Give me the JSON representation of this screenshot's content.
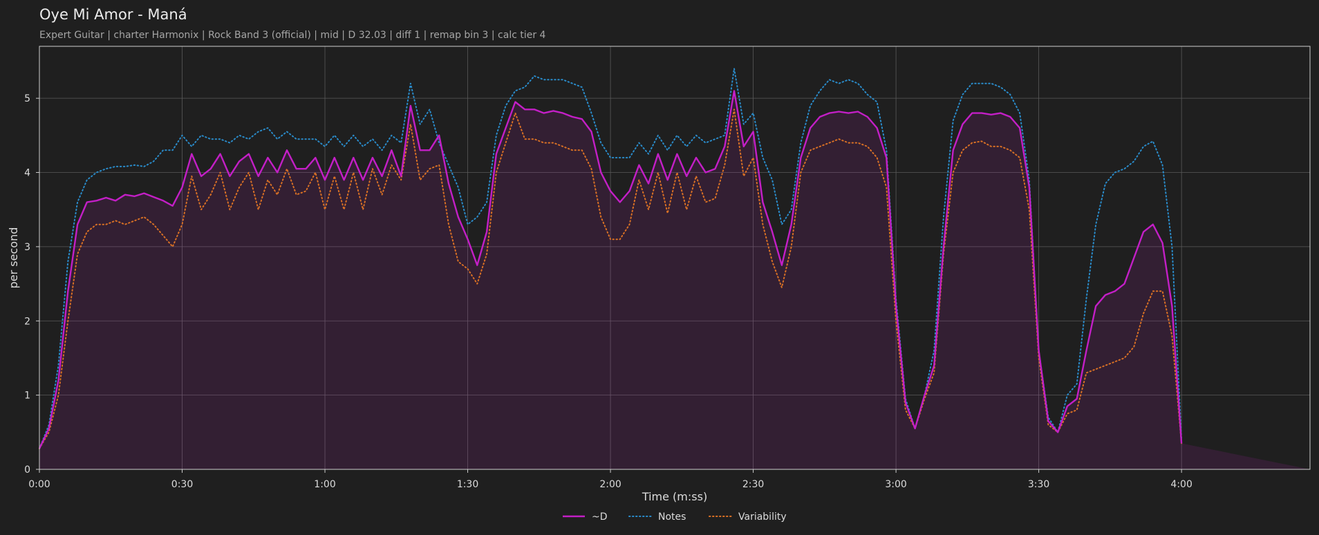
{
  "chart_data": {
    "type": "line",
    "title": "Oye Mi Amor - Maná",
    "subtitle": "Expert Guitar  |  charter Harmonix  |  Rock Band 3 (official)  |  mid  |  D 32.03  |  diff 1  |  remap bin 3  |  calc tier 4",
    "xlabel": "Time (m:ss)",
    "ylabel": "per second",
    "xlim": [
      0,
      267
    ],
    "ylim": [
      0,
      5.7
    ],
    "grid": true,
    "legend_position": "bottom-center",
    "x_ticks": [
      {
        "value": 0,
        "label": "0:00"
      },
      {
        "value": 30,
        "label": "0:30"
      },
      {
        "value": 60,
        "label": "1:00"
      },
      {
        "value": 90,
        "label": "1:30"
      },
      {
        "value": 120,
        "label": "2:00"
      },
      {
        "value": 150,
        "label": "2:30"
      },
      {
        "value": 180,
        "label": "3:00"
      },
      {
        "value": 210,
        "label": "3:30"
      },
      {
        "value": 240,
        "label": "4:00"
      }
    ],
    "y_ticks": [
      {
        "value": 0,
        "label": "0"
      },
      {
        "value": 1,
        "label": "1"
      },
      {
        "value": 2,
        "label": "2"
      },
      {
        "value": 3,
        "label": "3"
      },
      {
        "value": 4,
        "label": "4"
      },
      {
        "value": 5,
        "label": "5"
      }
    ],
    "x": [
      0,
      2,
      4,
      6,
      8,
      10,
      12,
      14,
      16,
      18,
      20,
      22,
      24,
      26,
      28,
      30,
      32,
      34,
      36,
      38,
      40,
      42,
      44,
      46,
      48,
      50,
      52,
      54,
      56,
      58,
      60,
      62,
      64,
      66,
      68,
      70,
      72,
      74,
      76,
      78,
      80,
      82,
      84,
      86,
      88,
      90,
      92,
      94,
      96,
      98,
      100,
      102,
      104,
      106,
      108,
      110,
      112,
      114,
      116,
      118,
      120,
      122,
      124,
      126,
      128,
      130,
      132,
      134,
      136,
      138,
      140,
      142,
      144,
      146,
      148,
      150,
      152,
      154,
      156,
      158,
      160,
      162,
      164,
      166,
      168,
      170,
      172,
      174,
      176,
      178,
      180,
      182,
      184,
      186,
      188,
      190,
      192,
      194,
      196,
      198,
      200,
      202,
      204,
      206,
      208,
      210,
      212,
      214,
      216,
      218,
      220,
      222,
      224,
      226,
      228,
      230,
      232,
      234,
      236,
      238,
      240,
      242,
      244,
      246,
      248,
      250,
      252,
      254,
      256,
      258,
      260,
      262,
      264,
      266,
      267
    ],
    "series": [
      {
        "name": "~D",
        "style": "solid",
        "color": "#c31fc6",
        "fill": true,
        "values": [
          0.28,
          0.55,
          1.2,
          2.4,
          3.3,
          3.6,
          3.62,
          3.66,
          3.62,
          3.7,
          3.68,
          3.72,
          3.67,
          3.62,
          3.55,
          3.8,
          4.25,
          3.95,
          4.05,
          4.25,
          3.95,
          4.15,
          4.25,
          3.95,
          4.2,
          4.0,
          4.3,
          4.05,
          4.05,
          4.2,
          3.9,
          4.2,
          3.9,
          4.2,
          3.9,
          4.2,
          3.95,
          4.3,
          3.95,
          4.9,
          4.3,
          4.3,
          4.5,
          3.85,
          3.4,
          3.1,
          2.75,
          3.2,
          4.25,
          4.6,
          4.95,
          4.85,
          4.85,
          4.8,
          4.83,
          4.8,
          4.75,
          4.72,
          4.55,
          4.0,
          3.75,
          3.6,
          3.75,
          4.1,
          3.85,
          4.25,
          3.9,
          4.25,
          3.95,
          4.2,
          4.0,
          4.05,
          4.35,
          5.1,
          4.35,
          4.55,
          3.6,
          3.2,
          2.75,
          3.3,
          4.2,
          4.6,
          4.75,
          4.8,
          4.82,
          4.8,
          4.82,
          4.75,
          4.6,
          4.2,
          2.2,
          0.9,
          0.55,
          1.0,
          1.4,
          3.0,
          4.3,
          4.65,
          4.8,
          4.8,
          4.78,
          4.8,
          4.75,
          4.6,
          3.8,
          1.6,
          0.65,
          0.5,
          0.85,
          0.95,
          1.6,
          2.2,
          2.35,
          2.4,
          2.5,
          2.85,
          3.2,
          3.3,
          3.05,
          2.2,
          0.35
        ]
      },
      {
        "name": "Notes",
        "style": "dotted",
        "color": "#2a8bc9",
        "fill": false,
        "values": [
          0.28,
          0.6,
          1.4,
          2.8,
          3.6,
          3.9,
          4.0,
          4.05,
          4.08,
          4.08,
          4.1,
          4.08,
          4.15,
          4.3,
          4.3,
          4.5,
          4.35,
          4.5,
          4.45,
          4.45,
          4.4,
          4.5,
          4.45,
          4.55,
          4.6,
          4.45,
          4.55,
          4.45,
          4.45,
          4.45,
          4.35,
          4.5,
          4.35,
          4.5,
          4.35,
          4.45,
          4.3,
          4.5,
          4.4,
          5.2,
          4.65,
          4.85,
          4.4,
          4.1,
          3.8,
          3.3,
          3.4,
          3.6,
          4.5,
          4.9,
          5.1,
          5.15,
          5.3,
          5.25,
          5.25,
          5.25,
          5.2,
          5.15,
          4.8,
          4.4,
          4.2,
          4.2,
          4.2,
          4.4,
          4.25,
          4.5,
          4.3,
          4.5,
          4.35,
          4.5,
          4.4,
          4.45,
          4.5,
          5.4,
          4.65,
          4.8,
          4.2,
          3.9,
          3.3,
          3.5,
          4.4,
          4.9,
          5.1,
          5.25,
          5.2,
          5.25,
          5.2,
          5.05,
          4.95,
          4.3,
          2.3,
          0.95,
          0.55,
          1.0,
          1.6,
          3.4,
          4.7,
          5.05,
          5.2,
          5.2,
          5.2,
          5.15,
          5.05,
          4.8,
          3.9,
          1.6,
          0.7,
          0.5,
          1.0,
          1.15,
          2.3,
          3.3,
          3.85,
          4.0,
          4.05,
          4.15,
          4.35,
          4.42,
          4.1,
          3.0,
          0.4
        ]
      },
      {
        "name": "Variability",
        "style": "dotted",
        "color": "#d87025",
        "fill": false,
        "values": [
          0.28,
          0.5,
          1.0,
          2.0,
          2.9,
          3.2,
          3.3,
          3.3,
          3.35,
          3.3,
          3.35,
          3.4,
          3.3,
          3.15,
          3.0,
          3.3,
          3.95,
          3.5,
          3.7,
          4.0,
          3.5,
          3.8,
          4.0,
          3.5,
          3.9,
          3.7,
          4.05,
          3.7,
          3.75,
          4.0,
          3.5,
          3.95,
          3.5,
          4.0,
          3.5,
          4.05,
          3.7,
          4.1,
          3.9,
          4.65,
          3.9,
          4.05,
          4.1,
          3.3,
          2.8,
          2.7,
          2.5,
          2.9,
          4.0,
          4.4,
          4.8,
          4.45,
          4.45,
          4.4,
          4.4,
          4.35,
          4.3,
          4.3,
          4.05,
          3.4,
          3.1,
          3.1,
          3.3,
          3.9,
          3.5,
          4.0,
          3.45,
          4.0,
          3.5,
          3.95,
          3.6,
          3.65,
          4.1,
          4.85,
          3.95,
          4.2,
          3.3,
          2.8,
          2.45,
          3.0,
          4.0,
          4.3,
          4.35,
          4.4,
          4.45,
          4.4,
          4.4,
          4.35,
          4.2,
          3.8,
          2.0,
          0.8,
          0.55,
          0.95,
          1.3,
          2.9,
          4.0,
          4.3,
          4.4,
          4.42,
          4.35,
          4.35,
          4.3,
          4.2,
          3.5,
          1.5,
          0.6,
          0.5,
          0.75,
          0.8,
          1.3,
          1.35,
          1.4,
          1.45,
          1.5,
          1.65,
          2.1,
          2.4,
          2.4,
          1.8,
          0.35
        ]
      }
    ],
    "legend": [
      {
        "name": "~D",
        "style": "solid",
        "color": "#c31fc6"
      },
      {
        "name": "Notes",
        "style": "dotted",
        "color": "#2a8bc9"
      },
      {
        "name": "Variability",
        "style": "dotted",
        "color": "#d87025"
      }
    ]
  }
}
